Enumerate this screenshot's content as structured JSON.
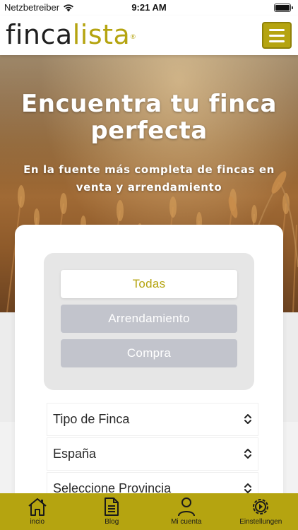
{
  "status_bar": {
    "carrier": "Netzbetreiber",
    "time": "9:21 AM"
  },
  "header": {
    "logo_part1": "finca",
    "logo_part2": "lista",
    "logo_mark": "®"
  },
  "hero": {
    "title": "Encuentra tu finca perfecta",
    "subtitle": "En la fuente más completa de fincas en venta y arrendamiento"
  },
  "search": {
    "segments": [
      {
        "label": "Todas",
        "active": true
      },
      {
        "label": "Arrendamiento",
        "active": false
      },
      {
        "label": "Compra",
        "active": false
      }
    ],
    "selects": [
      {
        "value": "Tipo de Finca"
      },
      {
        "value": "España"
      },
      {
        "value": "Seleccione Provincia"
      }
    ]
  },
  "tabbar": {
    "items": [
      {
        "label": "incio",
        "icon": "home-icon"
      },
      {
        "label": "Blog",
        "icon": "document-icon"
      },
      {
        "label": "Mi cuenta",
        "icon": "user-icon"
      },
      {
        "label": "Einstellungen",
        "icon": "settings-icon"
      }
    ]
  },
  "colors": {
    "brand": "#b5a410",
    "segment_inactive": "#c2c4cc"
  }
}
